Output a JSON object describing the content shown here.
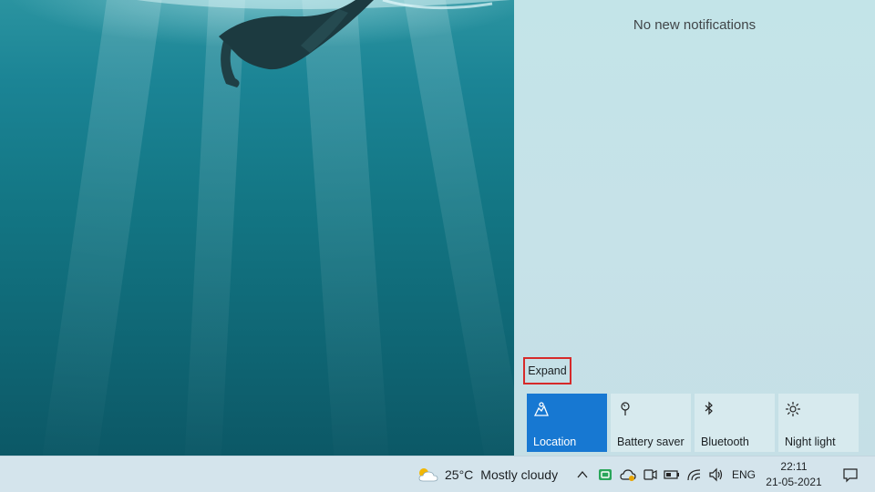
{
  "action_center": {
    "empty_message": "No new notifications",
    "expand_label": "Expand",
    "tiles": [
      {
        "label": "Location",
        "icon": "location-icon",
        "active": true
      },
      {
        "label": "Battery saver",
        "icon": "battery-saver-icon",
        "active": false
      },
      {
        "label": "Bluetooth",
        "icon": "bluetooth-icon",
        "active": false
      },
      {
        "label": "Night light",
        "icon": "night-light-icon",
        "active": false
      }
    ],
    "colors": {
      "active_tile": "#1778d2",
      "inactive_tile": "#d7eaee",
      "highlight_border": "#d62a2a"
    }
  },
  "taskbar": {
    "weather": {
      "icon": "partly-cloudy-icon",
      "temperature": "25°C",
      "description": "Mostly cloudy"
    },
    "tray_icons": [
      "chevron-up-icon",
      "app-tray-icon",
      "onedrive-icon",
      "meet-now-icon",
      "battery-icon",
      "wifi-icon",
      "volume-icon"
    ],
    "language": "ENG",
    "time": "22:11",
    "date": "21-05-2021",
    "notification_icon": "notifications-icon"
  }
}
